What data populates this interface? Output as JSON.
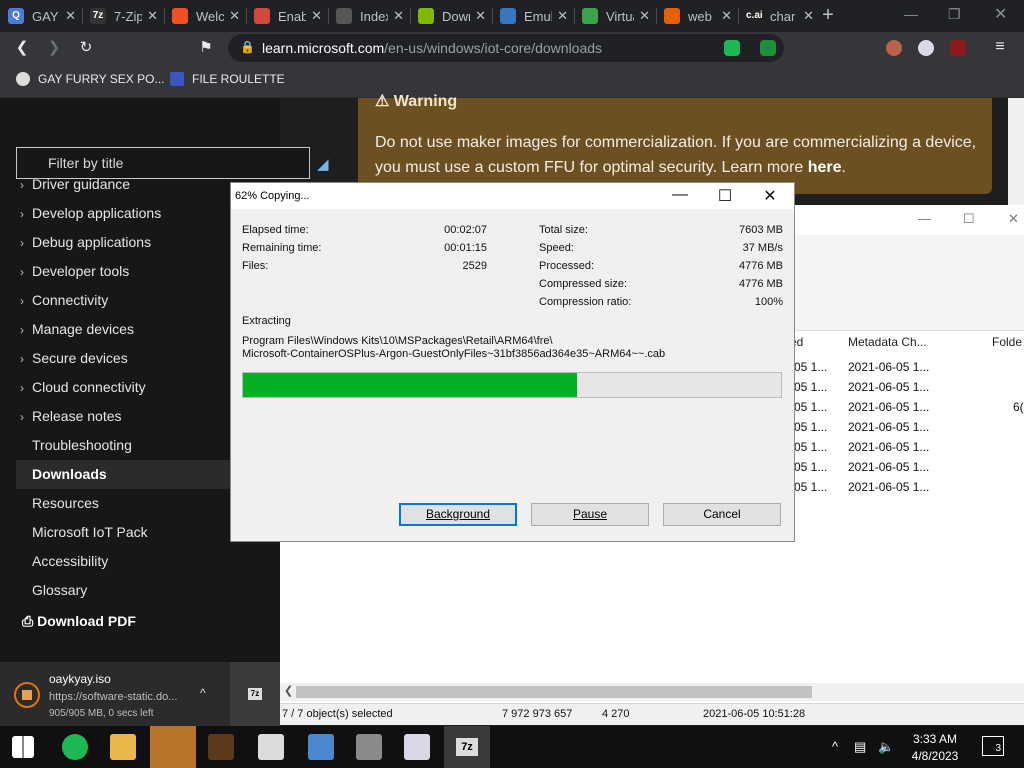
{
  "browser": {
    "tabs": [
      {
        "label": "GAY",
        "icon": "q-icon",
        "color": "#4c7bd9",
        "glyph": "Q"
      },
      {
        "label": "7-Zip",
        "icon": "7zip-icon",
        "color": "#333333",
        "glyph": "7z"
      },
      {
        "label": "Welcome",
        "icon": "microsoft-icon",
        "color": "#f25022",
        "glyph": ""
      },
      {
        "label": "Enable",
        "icon": "app-icon",
        "color": "#d14a3a",
        "glyph": ""
      },
      {
        "label": "Index",
        "icon": "globe-icon",
        "color": "#555555",
        "glyph": ""
      },
      {
        "label": "Downloads",
        "icon": "microsoft-icon",
        "color": "#7fba00",
        "glyph": ""
      },
      {
        "label": "Emulator",
        "icon": "bracket-icon",
        "color": "#3a76c4",
        "glyph": ""
      },
      {
        "label": "Virtual",
        "icon": "virtual-icon",
        "color": "#3aa34c",
        "glyph": ""
      },
      {
        "label": "web",
        "icon": "firefox-icon",
        "color": "#e66000",
        "glyph": ""
      },
      {
        "label": "char",
        "icon": "cai-icon",
        "color": "#222222",
        "glyph": "c.ai"
      }
    ],
    "url_domain": "learn.microsoft.com",
    "url_path": "/en-us/windows/iot-core/downloads",
    "bookmarks": [
      {
        "label": "GAY FURRY SEX PO..."
      },
      {
        "label": "FILE ROULETTE"
      }
    ]
  },
  "docs": {
    "filter_placeholder": "Filter by title",
    "nav": [
      {
        "label": "Driver guidance",
        "chevron": true
      },
      {
        "label": "Develop applications",
        "chevron": true
      },
      {
        "label": "Debug applications",
        "chevron": true
      },
      {
        "label": "Developer tools",
        "chevron": true
      },
      {
        "label": "Connectivity",
        "chevron": true
      },
      {
        "label": "Manage devices",
        "chevron": true
      },
      {
        "label": "Secure devices",
        "chevron": true
      },
      {
        "label": "Cloud connectivity",
        "chevron": true
      },
      {
        "label": "Release notes",
        "chevron": true
      },
      {
        "label": "Troubleshooting",
        "chevron": false
      },
      {
        "label": "Downloads",
        "chevron": false,
        "active": true
      },
      {
        "label": "Resources",
        "chevron": false
      },
      {
        "label": "Microsoft IoT Pack",
        "chevron": false
      },
      {
        "label": "Accessibility",
        "chevron": false
      },
      {
        "label": "Glossary",
        "chevron": false
      }
    ],
    "download_pdf": "Download PDF",
    "warning_title": "Warning",
    "warning_text": "Do not use maker images for commercialization. If you are commercializing a device, you must use a custom FFU for optimal security. Learn more ",
    "warning_link": "here",
    "warning_end": "."
  },
  "file_manager": {
    "columns": [
      "ed",
      "Metadata Ch...",
      "Folde"
    ],
    "rows": [
      {
        "c1": "05 1...",
        "c2": "2021-06-05 1...",
        "c3": ""
      },
      {
        "c1": "05 1...",
        "c2": "2021-06-05 1...",
        "c3": ""
      },
      {
        "c1": "05 1...",
        "c2": "2021-06-05 1...",
        "c3": "6("
      },
      {
        "c1": "05 1...",
        "c2": "2021-06-05 1...",
        "c3": ""
      },
      {
        "c1": "05 1...",
        "c2": "2021-06-05 1...",
        "c3": ""
      },
      {
        "c1": "05 1...",
        "c2": "2021-06-05 1...",
        "c3": ""
      },
      {
        "c1": "05 1...",
        "c2": "2021-06-05 1...",
        "c3": ""
      }
    ],
    "status": {
      "selected": "7 / 7 object(s) selected",
      "size": "7 972 973 657",
      "count": "4 270",
      "date": "2021-06-05 10:51:28"
    }
  },
  "copy_dialog": {
    "title": "62% Copying...",
    "progress": 0.62,
    "left_stats": [
      {
        "label": "Elapsed time:",
        "value": "00:02:07"
      },
      {
        "label": "Remaining time:",
        "value": "00:01:15"
      },
      {
        "label": "Files:",
        "value": "2529"
      }
    ],
    "right_stats": [
      {
        "label": "Total size:",
        "value": "7603 MB"
      },
      {
        "label": "Speed:",
        "value": "37 MB/s"
      },
      {
        "label": "Processed:",
        "value": "4776 MB"
      },
      {
        "label": "Compressed size:",
        "value": "4776 MB"
      },
      {
        "label": "Compression ratio:",
        "value": "100%"
      }
    ],
    "operation": "Extracting",
    "path_line1": "Program Files\\Windows Kits\\10\\MSPackages\\Retail\\ARM64\\fre\\",
    "path_line2": "Microsoft-ContainerOSPlus-Argon-GuestOnlyFiles~31bf3856ad364e35~ARM64~~.cab",
    "buttons": {
      "background": "Background",
      "pause": "Pause",
      "cancel": "Cancel"
    },
    "fill_color": "#06b025"
  },
  "download_shelf": {
    "filename": "oaykyay.iso",
    "url": "https://software-static.do...",
    "progress": "905/905 MB, 0 secs left"
  },
  "taskbar": {
    "time": "3:33 AM",
    "date": "4/8/2023",
    "notifications": "3"
  }
}
